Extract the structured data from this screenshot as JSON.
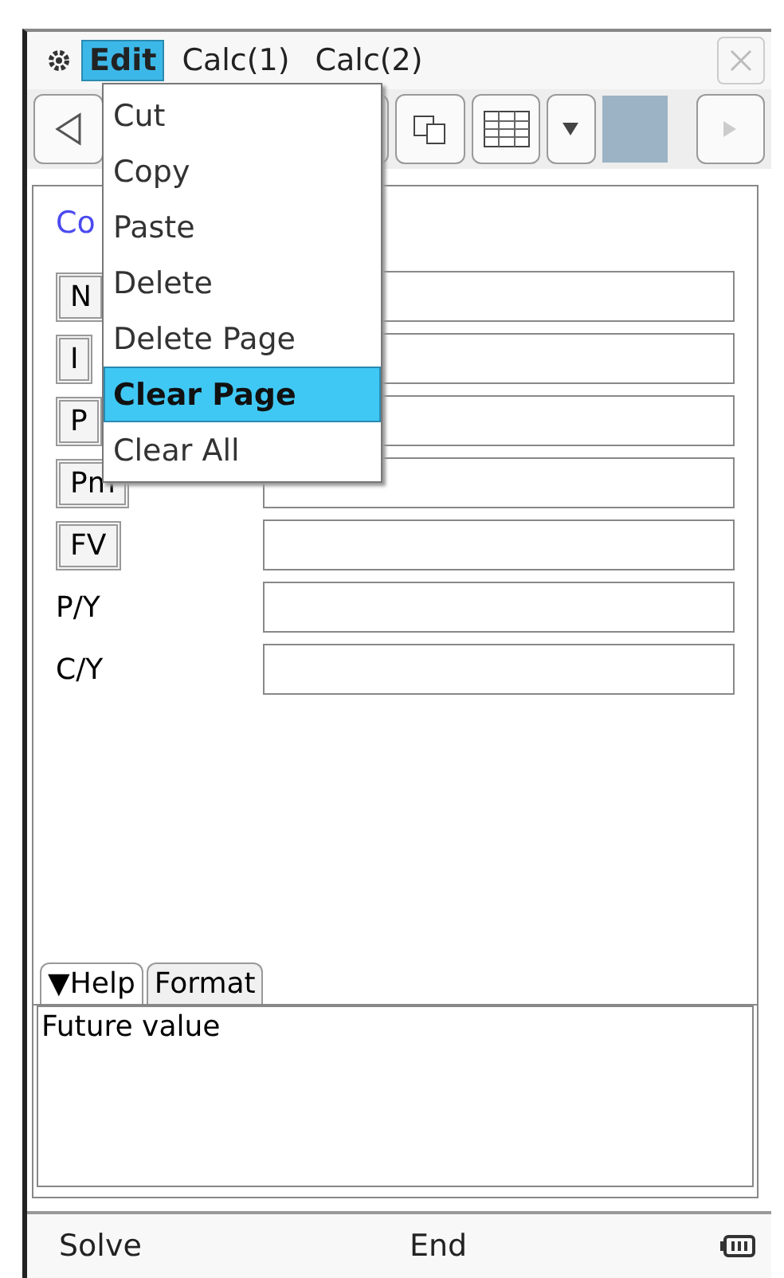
{
  "menubar": {
    "items": [
      {
        "label": "Edit",
        "selected": true
      },
      {
        "label": "Calc(1)",
        "selected": false
      },
      {
        "label": "Calc(2)",
        "selected": false
      }
    ]
  },
  "edit_menu": {
    "items": [
      {
        "label": "Cut",
        "selected": false
      },
      {
        "label": "Copy",
        "selected": false
      },
      {
        "label": "Paste",
        "selected": false
      },
      {
        "label": "Delete",
        "selected": false
      },
      {
        "label": "Delete Page",
        "selected": false
      },
      {
        "label": "Clear Page",
        "selected": true
      },
      {
        "label": "Clear All",
        "selected": false
      }
    ]
  },
  "title_fragment": "Co",
  "variables": [
    {
      "kind": "button",
      "label": "N"
    },
    {
      "kind": "button",
      "label": "I"
    },
    {
      "kind": "button",
      "label": "P"
    },
    {
      "kind": "button",
      "label": "Pm"
    },
    {
      "kind": "button",
      "label": "FV"
    },
    {
      "kind": "text",
      "label": "P/Y"
    },
    {
      "kind": "text",
      "label": "C/Y"
    }
  ],
  "tabs": [
    {
      "label": "▼Help",
      "selected": true
    },
    {
      "label": "Format",
      "selected": false
    }
  ],
  "help_text": "Future value",
  "soft_keys": [
    "Solve",
    "End"
  ]
}
